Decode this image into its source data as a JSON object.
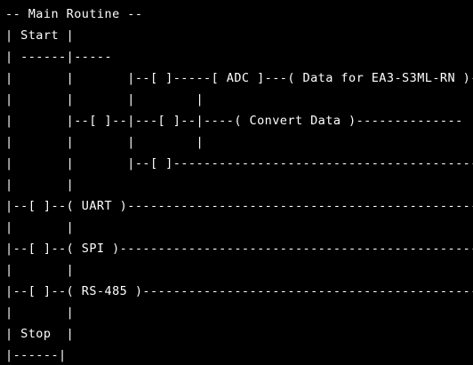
{
  "terminal": {
    "lines": [
      "-- Main Routine --",
      "| Start |",
      "| ------|-----",
      "|       |       |--[ ]-----[ ADC ]---( Data for EA3-S3ML-RN )--",
      "|       |       |        |",
      "|       |--[ ]--|---[ ]--|----( Convert Data )--------------",
      "|       |       |        |",
      "|       |       |--[ ]------------------------------------------",
      "|       |",
      "|--[ ]--( UART )-----------------------------------------------",
      "|       |",
      "|--[ ]--( SPI )------------------------------------------------",
      "|       |",
      "|--[ ]--( RS-485 )---------------------------------------------",
      "|       |",
      "| Stop  |",
      "|------|"
    ]
  },
  "colors": {
    "background": "#000000",
    "text": "#ffffff"
  }
}
